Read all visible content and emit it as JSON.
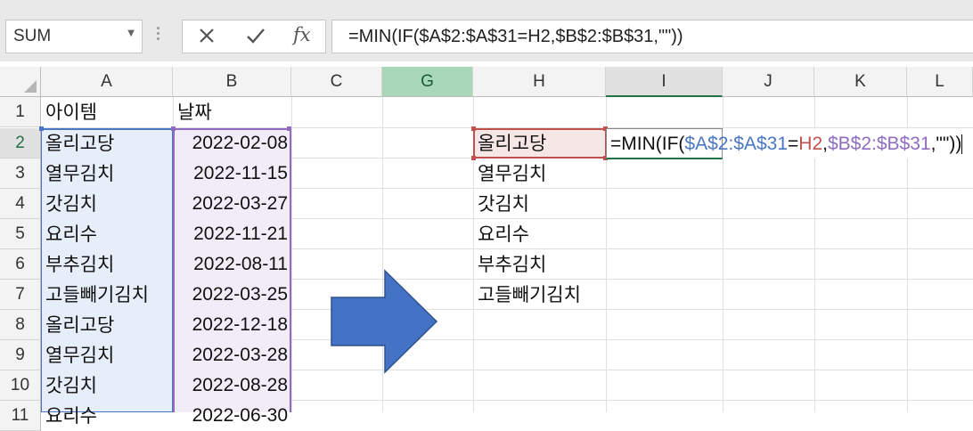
{
  "name_box": {
    "value": "SUM"
  },
  "formula_bar": {
    "cancel_icon": "close-icon",
    "confirm_icon": "check-icon",
    "function_icon": "fx",
    "formula": "=MIN(IF($A$2:$A$31=H2,$B$2:$B$31,\"\"))"
  },
  "columns": [
    "A",
    "B",
    "C",
    "G",
    "H",
    "I",
    "J",
    "K",
    "L"
  ],
  "rows": [
    "1",
    "2",
    "3",
    "4",
    "5",
    "6",
    "7",
    "8",
    "9",
    "10",
    "11"
  ],
  "column_a": [
    "아이템",
    "올리고당",
    "열무김치",
    "갓김치",
    "요리수",
    "부추김치",
    "고들빼기김치",
    "올리고당",
    "열무김치",
    "갓김치",
    "요리수"
  ],
  "column_b": [
    "날짜",
    "2022-02-08",
    "2022-11-15",
    "2022-03-27",
    "2022-11-21",
    "2022-08-11",
    "2022-03-25",
    "2022-12-18",
    "2022-03-28",
    "2022-08-28",
    "2022-06-30"
  ],
  "column_h": [
    "",
    "올리고당",
    "열무김치",
    "갓김치",
    "요리수",
    "부추김치",
    "고들빼기김치"
  ],
  "editing_cell": {
    "parts": [
      "=MIN(IF(",
      "$A$2:$A$31",
      "=",
      "H2",
      ",",
      "$B$2:$B$31",
      ",\"\"))"
    ]
  },
  "colors": {
    "range_a": "#4a77c4",
    "range_b": "#8f6cc0",
    "ref_h": "#c0504d",
    "arrow": "#4472c4",
    "selected_col": "#a9d7b9"
  },
  "arrow_icon": "right-arrow-shape"
}
